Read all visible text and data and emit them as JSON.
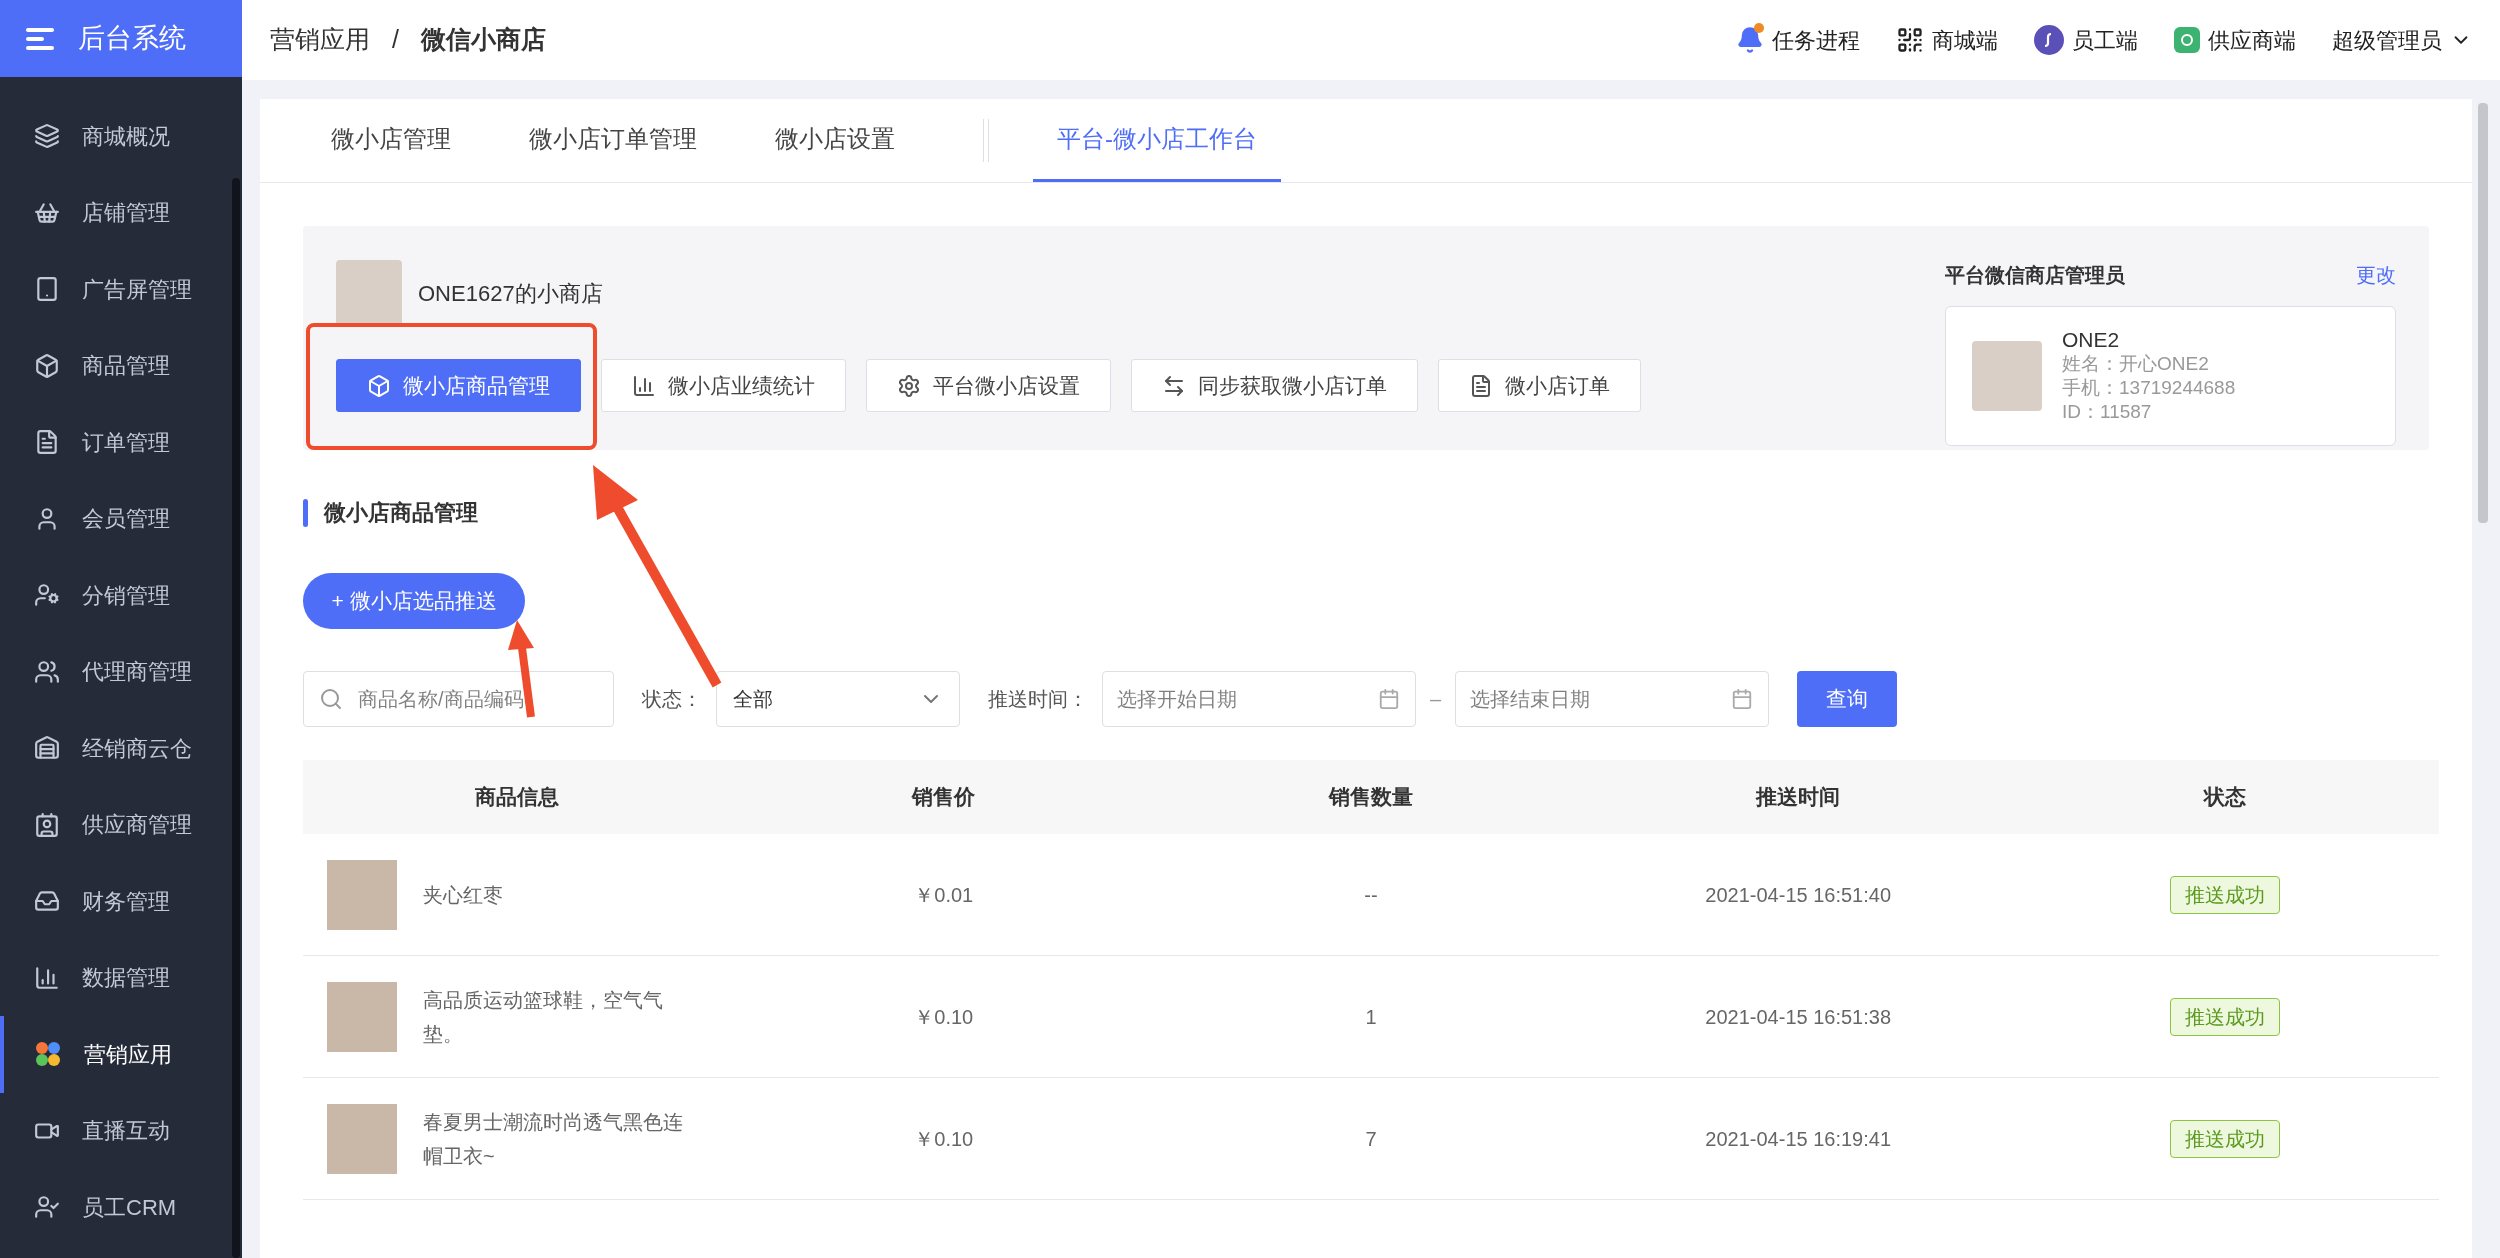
{
  "sidebar": {
    "logo_text": "后台系统",
    "items": [
      {
        "label": "商城概况",
        "selected": false
      },
      {
        "label": "店铺管理",
        "selected": false
      },
      {
        "label": "广告屏管理",
        "selected": false
      },
      {
        "label": "商品管理",
        "selected": false
      },
      {
        "label": "订单管理",
        "selected": false
      },
      {
        "label": "会员管理",
        "selected": false
      },
      {
        "label": "分销管理",
        "selected": false
      },
      {
        "label": "代理商管理",
        "selected": false
      },
      {
        "label": "经销商云仓",
        "selected": false
      },
      {
        "label": "供应商管理",
        "selected": false
      },
      {
        "label": "财务管理",
        "selected": false
      },
      {
        "label": "数据管理",
        "selected": false
      },
      {
        "label": "营销应用",
        "selected": true
      },
      {
        "label": "直播互动",
        "selected": false
      },
      {
        "label": "员工CRM",
        "selected": false
      }
    ]
  },
  "header": {
    "breadcrumb": [
      "营销应用",
      "微信小商店"
    ],
    "separator": "/",
    "actions": [
      {
        "label": "任务进程",
        "kind": "bell"
      },
      {
        "label": "商城端",
        "kind": "qr"
      },
      {
        "label": "员工端",
        "kind": "staff"
      },
      {
        "label": "供应商端",
        "kind": "supplier"
      }
    ],
    "user": "超级管理员"
  },
  "tabs": [
    {
      "label": "微小店管理",
      "selected": false
    },
    {
      "label": "微小店订单管理",
      "selected": false
    },
    {
      "label": "微小店设置",
      "selected": false
    },
    {
      "label": "平台-微小店工作台",
      "selected": true
    }
  ],
  "shop": {
    "name": "ONE1627的小商店",
    "buttons": [
      {
        "label": "微小店商品管理",
        "kind": "box",
        "selected": true
      },
      {
        "label": "微小店业绩统计",
        "kind": "chart",
        "selected": false
      },
      {
        "label": "平台微小店设置",
        "kind": "gear",
        "selected": false
      },
      {
        "label": "同步获取微小店订单",
        "kind": "sync",
        "selected": false
      },
      {
        "label": "微小店订单",
        "kind": "doc",
        "selected": false
      }
    ],
    "manager": {
      "title": "平台微信商店管理员",
      "edit": "更改",
      "name": "ONE2",
      "lines": [
        "姓名：开心ONE2",
        "手机：13719244688",
        "ID：11587"
      ]
    }
  },
  "section_title": "微小店商品管理",
  "add_button": "+ 微小店选品推送",
  "filters": {
    "search_placeholder": "商品名称/商品编码",
    "status_label": "状态：",
    "status_value": "全部",
    "time_label": "推送时间：",
    "start_placeholder": "选择开始日期",
    "dash": "–",
    "end_placeholder": "选择结束日期",
    "query": "查询"
  },
  "table": {
    "columns": [
      "商品信息",
      "销售价",
      "销售数量",
      "推送时间",
      "状态"
    ],
    "rows": [
      {
        "name": "夹心红枣",
        "price": "￥0.01",
        "quantity": "--",
        "time": "2021-04-15 16:51:40",
        "status": "推送成功"
      },
      {
        "name": "高品质运动篮球鞋，空气气垫。",
        "price": "￥0.10",
        "quantity": "1",
        "time": "2021-04-15 16:51:38",
        "status": "推送成功"
      },
      {
        "name": "春夏男士潮流时尚透气黑色连帽卫衣~",
        "price": "￥0.10",
        "quantity": "7",
        "time": "2021-04-15 16:19:41",
        "status": "推送成功"
      }
    ]
  }
}
